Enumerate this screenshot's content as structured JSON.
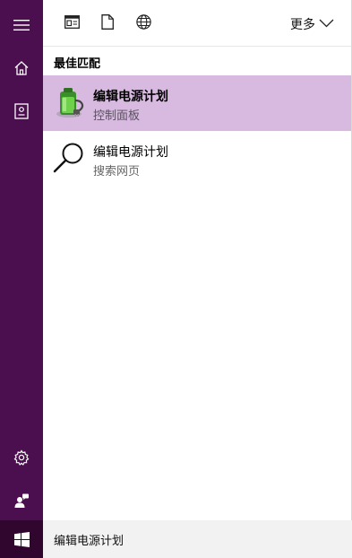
{
  "rail": {
    "icons": [
      "hamburger-menu-icon",
      "home-icon",
      "notebook-icon",
      "settings-gear-icon",
      "feedback-person-icon",
      "windows-logo-icon"
    ]
  },
  "filters": {
    "icons": [
      "apps-filter-icon",
      "documents-filter-icon",
      "web-filter-icon"
    ],
    "more_label": "更多"
  },
  "section_label": "最佳匹配",
  "results": [
    {
      "title": "编辑电源计划",
      "subtitle": "控制面板",
      "icon": "battery-power-icon",
      "selected": true
    },
    {
      "title": "编辑电源计划",
      "subtitle": "搜索网页",
      "icon": "search-magnifier-icon",
      "selected": false
    }
  ],
  "search": {
    "query": "编辑电源计划"
  },
  "colors": {
    "rail_bg": "#4b0e4e",
    "start_bg": "#30062f",
    "selected_bg": "#d8b9e0",
    "search_bg": "#f2f2f2"
  }
}
